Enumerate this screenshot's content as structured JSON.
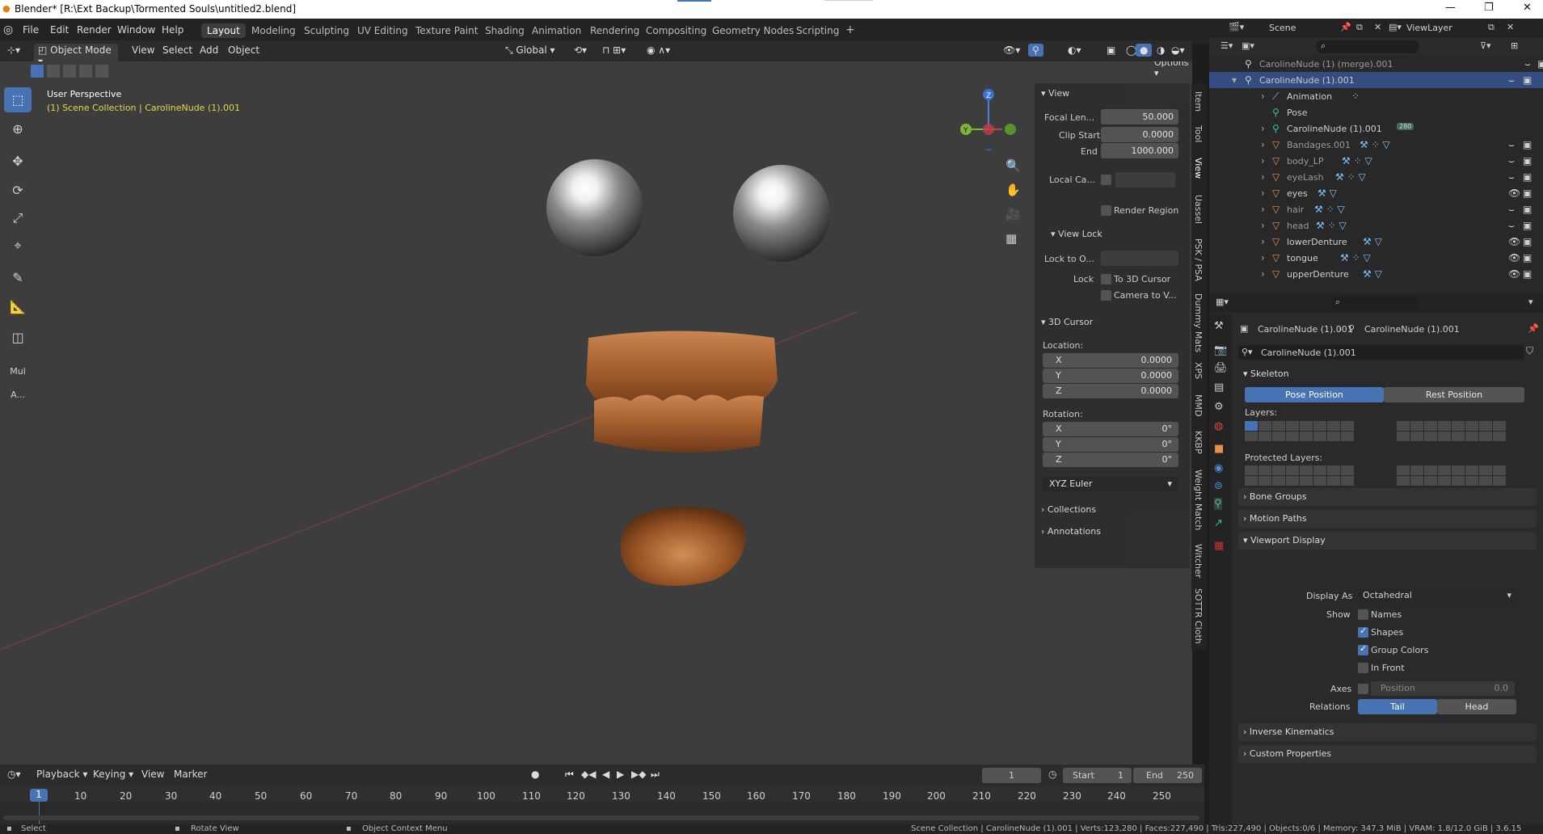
{
  "titlebar": {
    "title": "Blender* [R:\\Ext Backup\\Tormented Souls\\untitled2.blend]",
    "min": "—",
    "max": "❐",
    "close": "✕"
  },
  "menu": [
    "File",
    "Edit",
    "Render",
    "Window",
    "Help"
  ],
  "workspaces": [
    "Layout",
    "Modeling",
    "Sculpting",
    "UV Editing",
    "Texture Paint",
    "Shading",
    "Animation",
    "Rendering",
    "Compositing",
    "Geometry Nodes",
    "Scripting"
  ],
  "active_workspace": "Layout",
  "scene": {
    "label": "Scene",
    "view_layer": "ViewLayer"
  },
  "header3d": {
    "mode": "Object Mode",
    "view": "View",
    "select": "Select",
    "add": "Add",
    "object": "Object",
    "orientation": "Global",
    "options": "Options"
  },
  "viewport": {
    "perspective": "User Perspective",
    "collection": "(1) Scene Collection | CarolineNude (1).001",
    "tool_label_a": "A...",
    "tool_label_b": "Mul"
  },
  "npanel": {
    "view_section": "View",
    "focal_label": "Focal Len...",
    "focal_value": "50.000",
    "clip_start_label": "Clip Start",
    "clip_start_value": "0.0000",
    "end_label": "End",
    "end_value": "1000.000",
    "local_camera": "Local Ca...",
    "render_region": "Render Region",
    "view_lock": "View Lock",
    "lock_to_obj": "Lock to O...",
    "lock_label": "Lock",
    "to_3d_cursor": "To 3D Cursor",
    "camera_to_view": "Camera to V...",
    "cursor_section": "3D Cursor",
    "location": "Location:",
    "loc": [
      {
        "k": "X",
        "v": "0.0000"
      },
      {
        "k": "Y",
        "v": "0.0000"
      },
      {
        "k": "Z",
        "v": "0.0000"
      }
    ],
    "rotation": "Rotation:",
    "rot": [
      {
        "k": "X",
        "v": "0°"
      },
      {
        "k": "Y",
        "v": "0°"
      },
      {
        "k": "Z",
        "v": "0°"
      }
    ],
    "rot_mode": "XYZ Euler",
    "collections": "Collections",
    "annotations": "Annotations"
  },
  "side_tabs": [
    "Item",
    "Tool",
    "View",
    "Uassel",
    "PSK / PSA",
    "Dummy Mats",
    "XPS",
    "MMD",
    "KKBP",
    "Weight Match",
    "Witcher",
    "SOTTR Cloth"
  ],
  "outliner": {
    "rows": [
      {
        "name": "CarolineNude (1) (merge).001",
        "dim": true
      },
      {
        "name": "CarolineNude (1).001",
        "sel": true
      },
      {
        "name": "Animation"
      },
      {
        "name": "Pose"
      },
      {
        "name": "CarolineNude (1).001",
        "badge": "280"
      },
      {
        "name": "Bandages.001",
        "dim": true
      },
      {
        "name": "body_LP",
        "dim": true
      },
      {
        "name": "eyeLash",
        "dim": true
      },
      {
        "name": "eyes"
      },
      {
        "name": "hair",
        "dim": true
      },
      {
        "name": "head",
        "dim": true
      },
      {
        "name": "lowerDenture"
      },
      {
        "name": "tongue"
      },
      {
        "name": "upperDenture"
      }
    ]
  },
  "properties": {
    "crumb_a": "CarolineNude (1).001",
    "crumb_b": "CarolineNude (1).001",
    "data_name": "CarolineNude (1).001",
    "skeleton": "Skeleton",
    "pose_position": "Pose Position",
    "rest_position": "Rest Position",
    "layers": "Layers:",
    "protected_layers": "Protected Layers:",
    "bone_groups": "Bone Groups",
    "motion_paths": "Motion Paths",
    "viewport_display": "Viewport Display",
    "display_as_label": "Display As",
    "display_as_value": "Octahedral",
    "show_label": "Show",
    "names": "Names",
    "shapes": "Shapes",
    "group_colors": "Group Colors",
    "in_front": "In Front",
    "axes_label": "Axes",
    "axes_position": "Position",
    "axes_value": "0.0",
    "relations_label": "Relations",
    "tail": "Tail",
    "head": "Head",
    "ik": "Inverse Kinematics",
    "custom_props": "Custom Properties"
  },
  "timeline": {
    "playback": "Playback",
    "keying": "Keying",
    "view": "View",
    "marker": "Marker",
    "current_frame": "1",
    "start_label": "Start",
    "start": "1",
    "end_label": "End",
    "end": "250",
    "ticks": [
      "1",
      "10",
      "20",
      "30",
      "40",
      "50",
      "60",
      "70",
      "80",
      "90",
      "100",
      "110",
      "120",
      "130",
      "140",
      "150",
      "160",
      "170",
      "180",
      "190",
      "200",
      "210",
      "220",
      "230",
      "240",
      "250"
    ]
  },
  "statusbar": {
    "select": "Select",
    "rotate": "Rotate View",
    "context": "Object Context Menu",
    "info": "Scene Collection | CarolineNude (1).001 | Verts:123,280 | Faces:227,490 | Tris:227,490 | Objects:0/6 | Memory: 347.3 MiB | VRAM: 1.8/12.0 GiB | 3.6.15"
  },
  "colors": {
    "accent": "#4772b3",
    "selection": "#334d80",
    "bg": "#3d3d3d",
    "panel": "#2e2e2e"
  }
}
